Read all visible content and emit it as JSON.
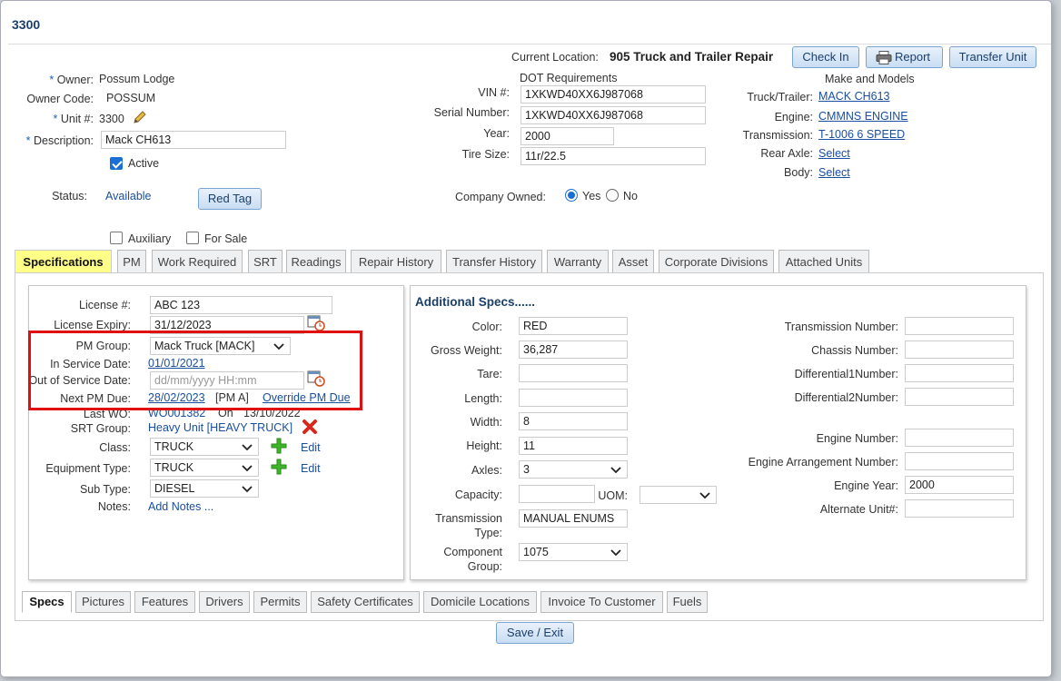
{
  "dialog": {
    "title": "3300"
  },
  "header": {
    "current_location_label": "Current Location:",
    "current_location_value": "905 Truck and Trailer Repair",
    "check_in": "Check In",
    "report": "Report",
    "transfer_unit": "Transfer Unit"
  },
  "owner": {
    "owner_label": "Owner:",
    "owner_value": "Possum Lodge",
    "code_label": "Owner Code:",
    "code_value": "POSSUM",
    "unit_label": "Unit #:",
    "unit_value": "3300",
    "desc_label": "Description:",
    "desc_value": "Mack CH613",
    "active_label": "Active",
    "status_label": "Status:",
    "status_value": "Available",
    "red_tag": "Red Tag",
    "auxiliary": "Auxiliary",
    "for_sale": "For Sale"
  },
  "dot": {
    "heading": "DOT Requirements",
    "vin_label": "VIN #:",
    "vin_value": "1XKWD40XX6J987068",
    "serial_label": "Serial Number:",
    "serial_value": "1XKWD40XX6J987068",
    "year_label": "Year:",
    "year_value": "2000",
    "tire_label": "Tire Size:",
    "tire_value": "11r/22.5",
    "company_owned_label": "Company Owned:",
    "yes": "Yes",
    "no": "No"
  },
  "models": {
    "heading": "Make and Models",
    "truck_label": "Truck/Trailer:",
    "truck_value": "MACK CH613",
    "engine_label": "Engine:",
    "engine_value": "CMMNS ENGINE",
    "trans_label": "Transmission:",
    "trans_value": "T-1006 6 SPEED",
    "rear_label": "Rear Axle:",
    "rear_value": "Select",
    "body_label": "Body:",
    "body_value": "Select"
  },
  "tabs": [
    "Specifications",
    "PM",
    "Work Required",
    "SRT",
    "Readings",
    "Repair History",
    "Transfer History",
    "Warranty",
    "Asset",
    "Corporate Divisions",
    "Attached Units"
  ],
  "left": {
    "license_label": "License #:",
    "license_value": "ABC 123",
    "expiry_label": "License Expiry:",
    "expiry_value": "31/12/2023",
    "pm_group_label": "PM Group:",
    "pm_group_value": "Mack Truck [MACK]",
    "in_service_label": "In Service Date:",
    "in_service_value": "01/01/2021",
    "out_service_label": "Out of Service Date:",
    "out_service_placeholder": "dd/mm/yyyy HH:mm",
    "next_pm_label": "Next PM Due:",
    "next_pm_value": "28/02/2023",
    "next_pm_tag": "[PM A]",
    "override": "Override PM Due",
    "last_wo_label": "Last WO:",
    "last_wo_value": "WO001382",
    "last_wo_on": "On",
    "last_wo_date": "13/10/2022",
    "srt_label": "SRT Group:",
    "srt_value": "Heavy Unit [HEAVY TRUCK]",
    "class_label": "Class:",
    "class_value": "TRUCK",
    "equip_label": "Equipment Type:",
    "equip_value": "TRUCK",
    "sub_label": "Sub Type:",
    "sub_value": "DIESEL",
    "notes_label": "Notes:",
    "notes_value": "Add Notes ...",
    "edit": "Edit"
  },
  "specs": {
    "heading": "Additional Specs......",
    "color_label": "Color:",
    "color_value": "RED",
    "gross_label": "Gross Weight:",
    "gross_value": "36,287",
    "tare_label": "Tare:",
    "tare_value": "",
    "length_label": "Length:",
    "length_value": "",
    "width_label": "Width:",
    "width_value": "8",
    "height_label": "Height:",
    "height_value": "11",
    "axles_label": "Axles:",
    "axles_value": "3",
    "capacity_label": "Capacity:",
    "capacity_value": "",
    "uom_label": "UOM:",
    "uom_value": "",
    "trans_type_label_1": "Transmission",
    "trans_type_label_2": "Type:",
    "trans_type_value": "MANUAL ENUMS",
    "comp_label_1": "Component",
    "comp_label_2": "Group:",
    "comp_value": "1075",
    "trans_num_label": "Transmission Number:",
    "chassis_label": "Chassis Number:",
    "diff1_label": "Differential1Number:",
    "diff2_label": "Differential2Number:",
    "engine_num_label": "Engine Number:",
    "engine_arr_label": "Engine Arrangement Number:",
    "engine_year_label": "Engine Year:",
    "engine_year_value": "2000",
    "alt_unit_label": "Alternate Unit#:"
  },
  "bottom_tabs": [
    "Specs",
    "Pictures",
    "Features",
    "Drivers",
    "Permits",
    "Safety Certificates",
    "Domicile Locations",
    "Invoice To Customer",
    "Fuels"
  ],
  "footer": {
    "save_exit": "Save / Exit"
  },
  "colors": {
    "accent": "#1a4fa0",
    "highlight": "#e01010",
    "active_tab": "#ffff88"
  }
}
